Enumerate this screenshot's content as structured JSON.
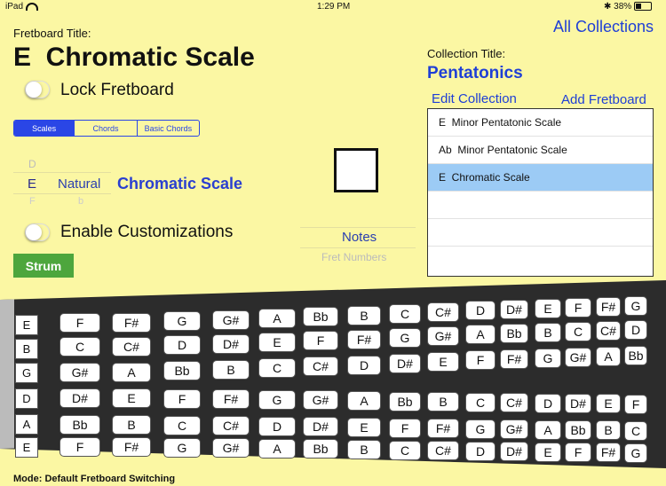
{
  "status_bar": {
    "device": "iPad",
    "time": "1:29 PM",
    "battery_text": "38%",
    "battery_level": 0.38
  },
  "nav": {
    "all_collections": "All Collections"
  },
  "fretboard": {
    "title_label": "Fretboard Title:",
    "title": "E  Chromatic Scale",
    "lock_label": "Lock Fretboard",
    "lock_on": false
  },
  "tabs": {
    "items": [
      "Scales",
      "Chords",
      "Basic Chords"
    ],
    "selected": "Scales"
  },
  "picker": {
    "root_prev": "D",
    "root": "E",
    "root_next": "F",
    "accidental": "Natural",
    "accidental_next": "b",
    "scale": "Chromatic Scale"
  },
  "customizations": {
    "label": "Enable Customizations",
    "on": false
  },
  "display_picker": {
    "selected": "Notes",
    "next": "Fret Numbers"
  },
  "strum_label": "Strum",
  "collection": {
    "title_label": "Collection Title:",
    "title": "Pentatonics",
    "edit_label": "Edit Collection",
    "add_label": "Add Fretboard",
    "items": [
      "E  Minor Pentatonic Scale",
      "Ab  Minor Pentatonic Scale",
      "E  Chromatic Scale"
    ],
    "selected_index": 2
  },
  "strings": [
    {
      "label": "E",
      "notes": [
        "F",
        "F#",
        "G",
        "G#",
        "A",
        "Bb",
        "B",
        "C",
        "C#",
        "D",
        "D#",
        "E",
        "F",
        "F#",
        "G"
      ]
    },
    {
      "label": "B",
      "notes": [
        "C",
        "C#",
        "D",
        "D#",
        "E",
        "F",
        "F#",
        "G",
        "G#",
        "A",
        "Bb",
        "B",
        "C",
        "C#",
        "D"
      ]
    },
    {
      "label": "G",
      "notes": [
        "G#",
        "A",
        "Bb",
        "B",
        "C",
        "C#",
        "D",
        "D#",
        "E",
        "F",
        "F#",
        "G",
        "G#",
        "A",
        "Bb"
      ]
    },
    {
      "label": "D",
      "notes": [
        "D#",
        "E",
        "F",
        "F#",
        "G",
        "G#",
        "A",
        "Bb",
        "B",
        "C",
        "C#",
        "D",
        "D#",
        "E",
        "F"
      ]
    },
    {
      "label": "A",
      "notes": [
        "Bb",
        "B",
        "C",
        "C#",
        "D",
        "D#",
        "E",
        "F",
        "F#",
        "G",
        "G#",
        "A",
        "Bb",
        "B",
        "C"
      ]
    },
    {
      "label": "E",
      "notes": [
        "F",
        "F#",
        "G",
        "G#",
        "A",
        "Bb",
        "B",
        "C",
        "C#",
        "D",
        "D#",
        "E",
        "F",
        "F#",
        "G"
      ]
    }
  ],
  "mode_text": "Mode: Default Fretboard Switching"
}
